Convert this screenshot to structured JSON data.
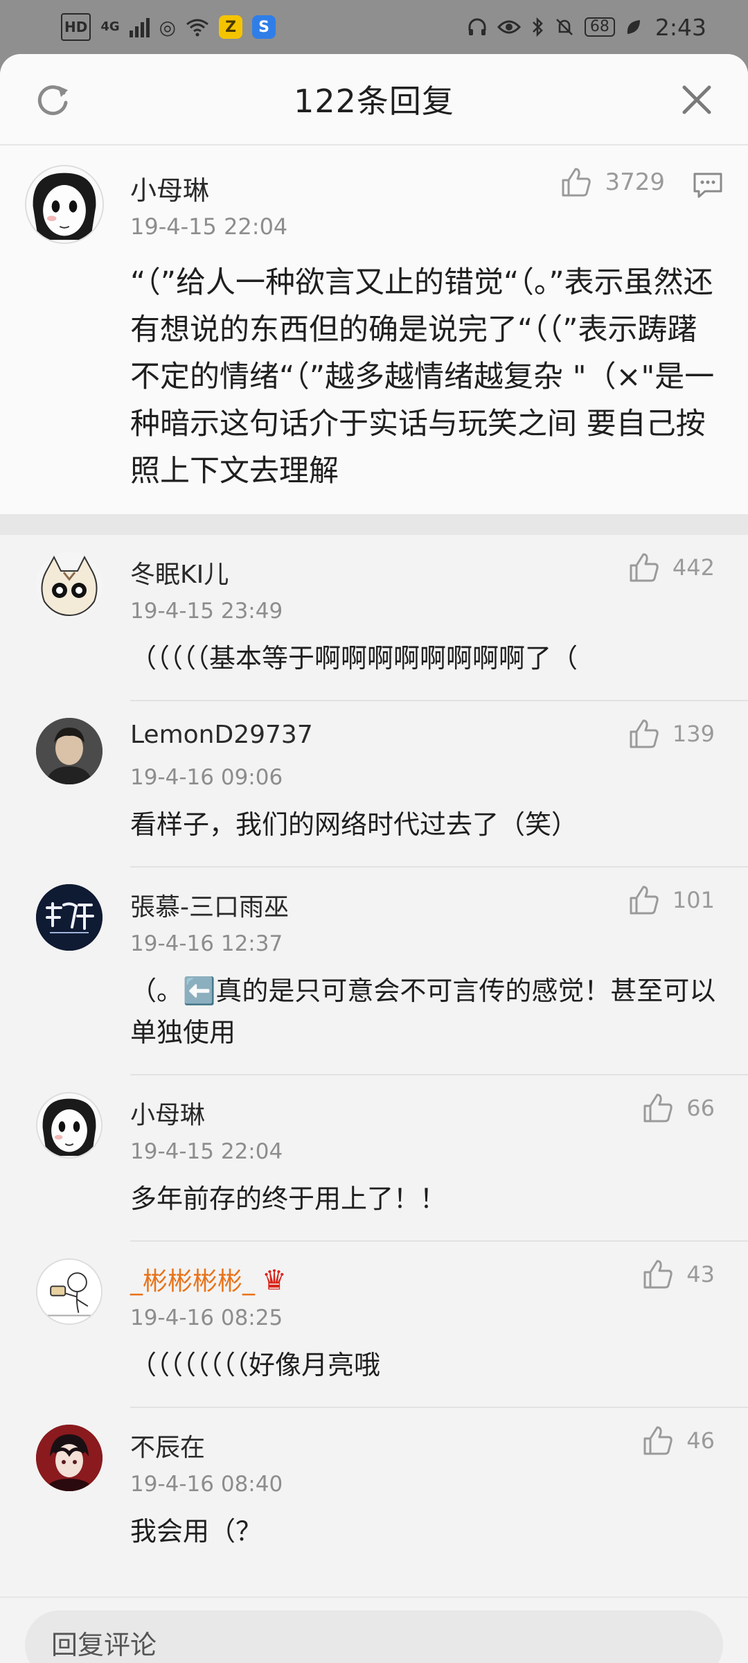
{
  "status_bar": {
    "network_hd": "HD",
    "network_type": "4G",
    "app_badge_1": "Z",
    "app_badge_2": "S",
    "battery": "68",
    "time": "2:43"
  },
  "header": {
    "title": "122条回复",
    "refresh_icon": "refresh-icon",
    "close_icon": "close-icon"
  },
  "main_comment": {
    "user": "小母琳",
    "date": "19-4-15 22:04",
    "likes": "3729",
    "text": "“（”给人一种欲言又止的错觉“（。”表示虽然还有想说的东西但的确是说完了“（（”表示踌躇不定的情绪“（”越多越情绪越复杂 \"（×\"是一种暗示这句话介于实话与玩笑之间 要自己按照上下文去理解"
  },
  "replies": [
    {
      "user": "冬眠KI儿",
      "date": "19-4-15 23:49",
      "likes": "442",
      "text": "（（（（（基本等于啊啊啊啊啊啊啊啊了（"
    },
    {
      "user": "LemonD29737",
      "date": "19-4-16 09:06",
      "likes": "139",
      "text": "看样子，我们的网络时代过去了（笑）"
    },
    {
      "user": "張慕-三口雨巫",
      "date": "19-4-16 12:37",
      "likes": "101",
      "text": "（。⬅️真的是只可意会不可言传的感觉！甚至可以单独使用"
    },
    {
      "user": "小母琳",
      "date": "19-4-15 22:04",
      "likes": "66",
      "text": "多年前存的终于用上了！！"
    },
    {
      "user": "_彬彬彬彬_",
      "date": "19-4-16 08:25",
      "likes": "43",
      "text": "（（（（（（（（好像月亮哦"
    },
    {
      "user": "不辰在",
      "date": "19-4-16 08:40",
      "likes": "46",
      "text": "我会用（？"
    }
  ],
  "input": {
    "placeholder": "回复评论"
  },
  "colors": {
    "vip_name": "#e8731a",
    "accent_gray": "#9a9a9a"
  }
}
